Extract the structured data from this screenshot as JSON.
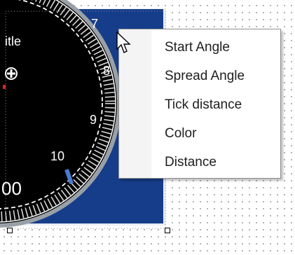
{
  "gauge": {
    "title_fragment": "itle",
    "tick_labels": {
      "t7": "7",
      "t8": "8",
      "t9": "9",
      "t10": "10"
    },
    "value_fragment": "00",
    "accent_color": "#4a7bd0",
    "panel_color": "#163d8a"
  },
  "context_menu": {
    "items": [
      {
        "label": "Start Angle"
      },
      {
        "label": "Spread Angle"
      },
      {
        "label": "Tick distance"
      },
      {
        "label": "Color"
      },
      {
        "label": "Distance"
      }
    ]
  },
  "icons": {
    "cursor": "arrow-cursor-icon",
    "gauge_button": "plus-circle-icon"
  }
}
